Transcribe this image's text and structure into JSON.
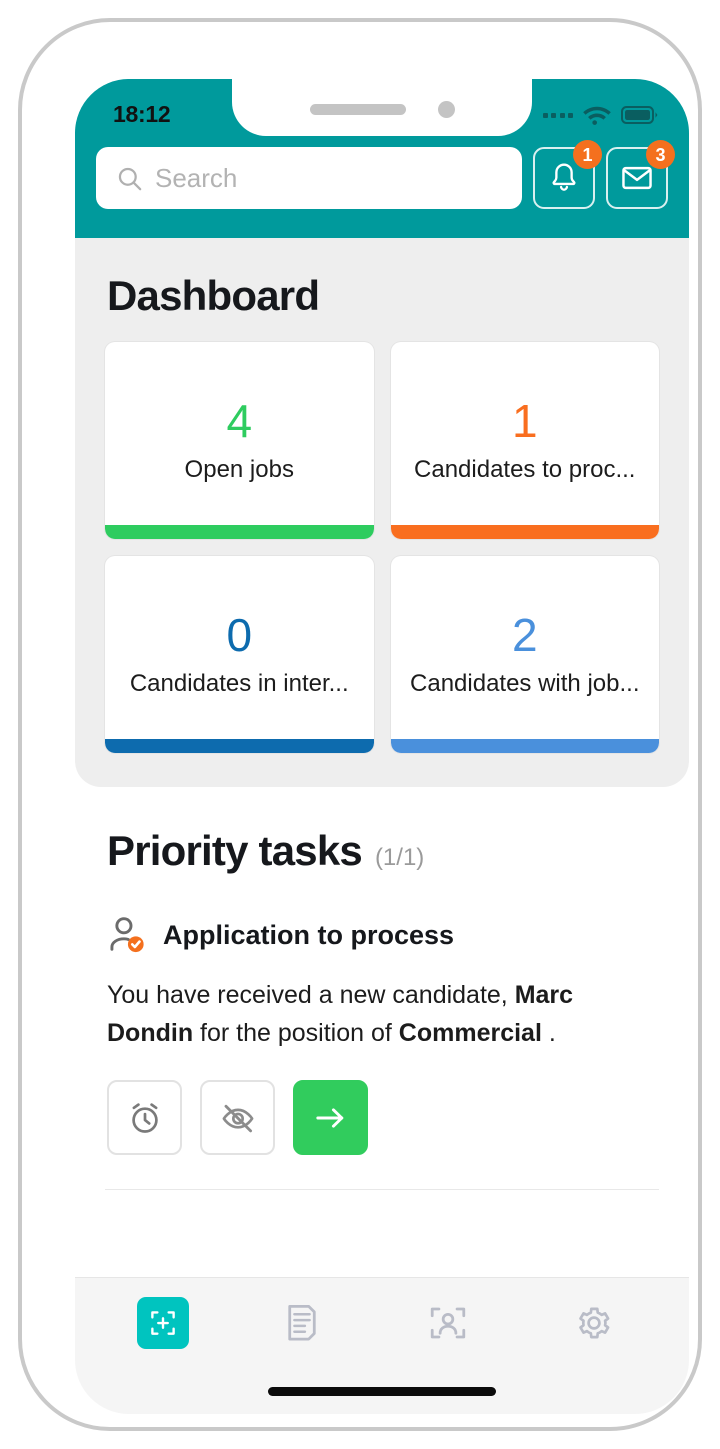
{
  "status_bar": {
    "time": "18:12",
    "signal_icon": "signal-dots-icon",
    "wifi_icon": "wifi-icon",
    "battery_icon": "battery-icon"
  },
  "header": {
    "background_color": "#009a9c",
    "search": {
      "placeholder": "Search",
      "value": "",
      "icon": "search-icon"
    },
    "notifications_button": {
      "icon": "bell-icon",
      "badge": "1",
      "badge_color": "#f4701e"
    },
    "messages_button": {
      "icon": "envelope-icon",
      "badge": "3",
      "badge_color": "#f4701e"
    }
  },
  "dashboard": {
    "title": "Dashboard",
    "cards": [
      {
        "value": "4",
        "label": "Open jobs",
        "color": "#2ecc5f"
      },
      {
        "value": "1",
        "label": "Candidates to proc...",
        "color": "#f96e1f"
      },
      {
        "value": "0",
        "label": "Candidates in inter...",
        "color": "#0d6bae"
      },
      {
        "value": "2",
        "label": "Candidates with job...",
        "color": "#4a90dc"
      }
    ]
  },
  "priority_tasks": {
    "title": "Priority tasks",
    "count": "(1/1)",
    "task": {
      "icon": "user-check-icon",
      "title": "Application to process",
      "description_prefix": "You have received a new candidate, ",
      "candidate_name": "Marc Dondin",
      "description_middle": " for the position of ",
      "position": "Commercial",
      "description_suffix": " .",
      "actions": [
        {
          "name": "snooze-button",
          "icon": "alarm-clock-icon",
          "primary": false
        },
        {
          "name": "hide-button",
          "icon": "eye-off-icon",
          "primary": false
        },
        {
          "name": "open-button",
          "icon": "arrow-right-icon",
          "primary": true,
          "color": "#31cc5d"
        }
      ]
    }
  },
  "bottom_nav": {
    "active_color": "#00c4bf",
    "items": [
      {
        "name": "nav-dashboard",
        "icon": "dashboard-grid-icon",
        "active": true
      },
      {
        "name": "nav-documents",
        "icon": "document-icon",
        "active": false
      },
      {
        "name": "nav-candidates",
        "icon": "candidate-scan-icon",
        "active": false
      },
      {
        "name": "nav-settings",
        "icon": "gear-icon",
        "active": false
      }
    ]
  }
}
